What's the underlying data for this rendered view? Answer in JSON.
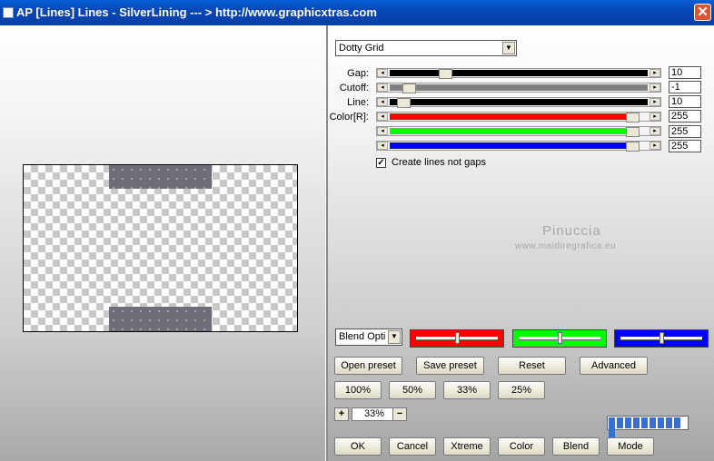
{
  "window": {
    "title": "AP [Lines]  Lines - SilverLining       --- > http://www.graphicxtras.com",
    "close_symbol": "✕"
  },
  "preset_dropdown": {
    "value": "Dotty Grid",
    "arrow": "▼"
  },
  "sliders": [
    {
      "label": "Gap:",
      "value": "10",
      "fill_color": "#000000",
      "fill_fraction": 0.2
    },
    {
      "label": "Cutoff:",
      "value": "-1",
      "fill_color": "#808080",
      "fill_fraction": 0.05
    },
    {
      "label": "Line:",
      "value": "10",
      "fill_color": "#000000",
      "fill_fraction": 0.03
    },
    {
      "label": "Color[R]:",
      "value": "255",
      "fill_color": "#ff0000",
      "fill_fraction": 1.0
    },
    {
      "label": "",
      "value": "255",
      "fill_color": "#00ff00",
      "fill_fraction": 1.0
    },
    {
      "label": "",
      "value": "255",
      "fill_color": "#0000ff",
      "fill_fraction": 1.0
    }
  ],
  "slider_arrows": {
    "left": "◂",
    "right": "▸"
  },
  "create_lines_checkbox": {
    "label": "Create lines not gaps",
    "checked": true,
    "mark": "✓"
  },
  "watermark": {
    "name": "Pinuccia",
    "url": "www.maidiregrafica.eu"
  },
  "blend_dropdown": {
    "value": "Blend Optio",
    "arrow": "▼"
  },
  "color_boxes": [
    {
      "color": "#ff0000",
      "level": 0.5
    },
    {
      "color": "#00ff00",
      "level": 0.5
    },
    {
      "color": "#0000ff",
      "level": 0.5
    }
  ],
  "buttons": {
    "open_preset": "Open preset",
    "save_preset": "Save preset",
    "reset": "Reset",
    "advanced": "Advanced",
    "zoom_100": "100%",
    "zoom_50": "50%",
    "zoom_33": "33%",
    "zoom_25": "25%",
    "ok": "OK",
    "cancel": "Cancel",
    "xtreme": "Xtreme",
    "color": "Color",
    "blend": "Blend",
    "mode": "Mode"
  },
  "zoom": {
    "plus": "+",
    "minus": "−",
    "value": "33%"
  },
  "progress": {
    "segments": 10
  },
  "colors": {
    "title_bar": "#0a5fd8",
    "grid_fill": "#6f6d78"
  }
}
